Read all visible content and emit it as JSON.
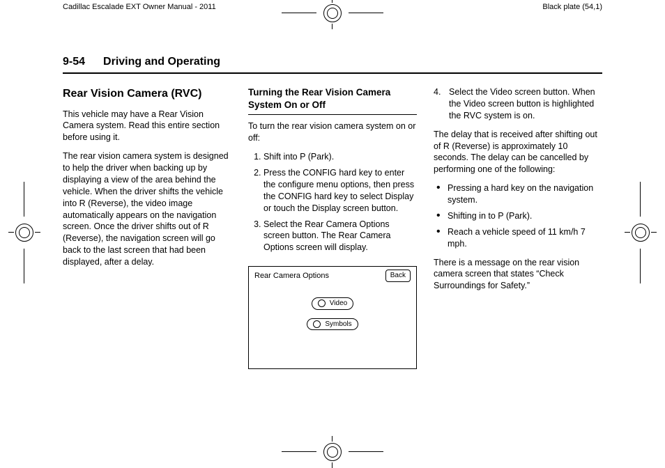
{
  "crop": {
    "left_header": "Cadillac Escalade EXT Owner Manual - 2011",
    "right_header": "Black plate (54,1)"
  },
  "header": {
    "page_number": "9-54",
    "chapter": "Driving and Operating"
  },
  "col1": {
    "section_title": "Rear Vision Camera (RVC)",
    "p1": "This vehicle may have a Rear Vision Camera system. Read this entire section before using it.",
    "p2": "The rear vision camera system is designed to help the driver when backing up by displaying a view of the area behind the vehicle. When the driver shifts the vehicle into R (Reverse), the video image automatically appears on the navigation screen. Once the driver shifts out of R (Reverse), the navigation screen will go back to the last screen that had been displayed, after a delay."
  },
  "col2": {
    "sub_title": "Turning the Rear Vision Camera System On or Off",
    "intro": "To turn the rear vision camera system on or off:",
    "steps": [
      "Shift into P (Park).",
      "Press the CONFIG hard key to enter the configure menu options, then press the CONFIG hard key to select Display or touch the Display screen button.",
      "Select the Rear Camera Options screen button. The Rear Camera Options screen will display."
    ],
    "figure": {
      "title": "Rear Camera Options",
      "back": "Back",
      "opt1": "Video",
      "opt2": "Symbols"
    }
  },
  "col3": {
    "step4_num": "4.",
    "step4": "Select the Video screen button. When the Video screen button is highlighted the RVC system is on.",
    "p1": "The delay that is received after shifting out of R (Reverse) is approximately 10 seconds. The delay can be cancelled by performing one of the following:",
    "bullets": [
      "Pressing a hard key on the navigation system.",
      "Shifting in to P (Park).",
      "Reach a vehicle speed of 11 km/h 7 mph."
    ],
    "p2": "There is a message on the rear vision camera screen that states “Check Surroundings for Safety.”"
  }
}
